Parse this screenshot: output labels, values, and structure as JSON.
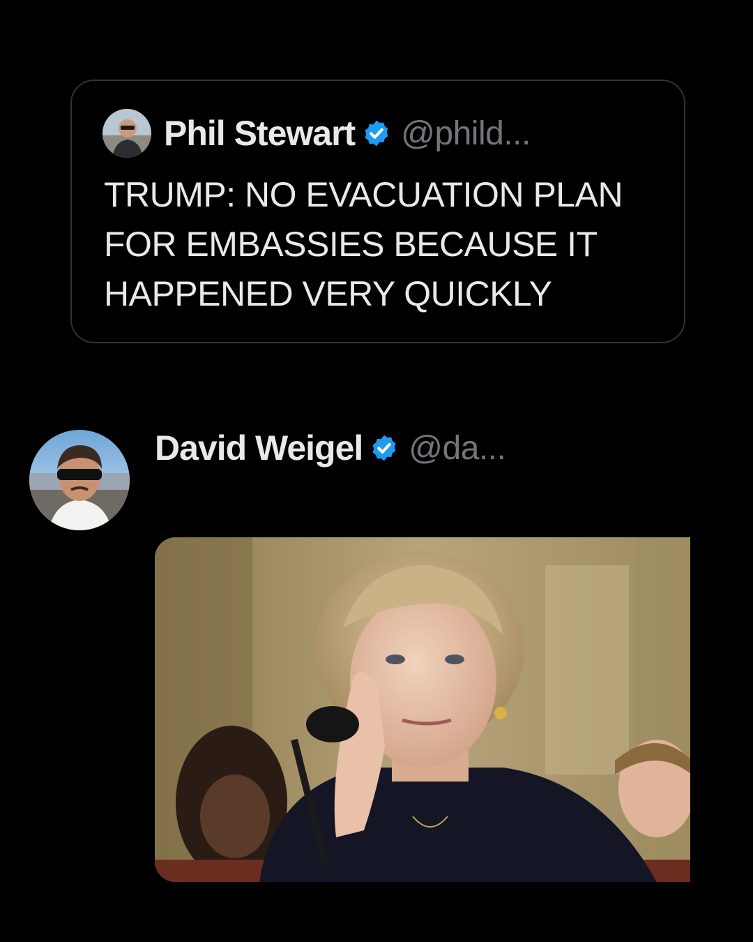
{
  "quoted_tweet": {
    "author_name": "Phil Stewart",
    "author_handle": "@phild...",
    "verified": true,
    "avatar_icon": "user-avatar",
    "text": "TRUMP: NO EVACUATION PLAN FOR EMBASSIES BECAUSE IT HAPPENED VERY QUICKLY"
  },
  "reply_tweet": {
    "author_name": "David Weigel",
    "author_handle": "@da...",
    "verified": true,
    "avatar_icon": "user-avatar",
    "media_icon": "photo-image"
  },
  "colors": {
    "background": "#000000",
    "card_border": "#2f3336",
    "primary_text": "#e7e9ea",
    "secondary_text": "#71767b",
    "verified_badge": "#1d9bf0"
  }
}
